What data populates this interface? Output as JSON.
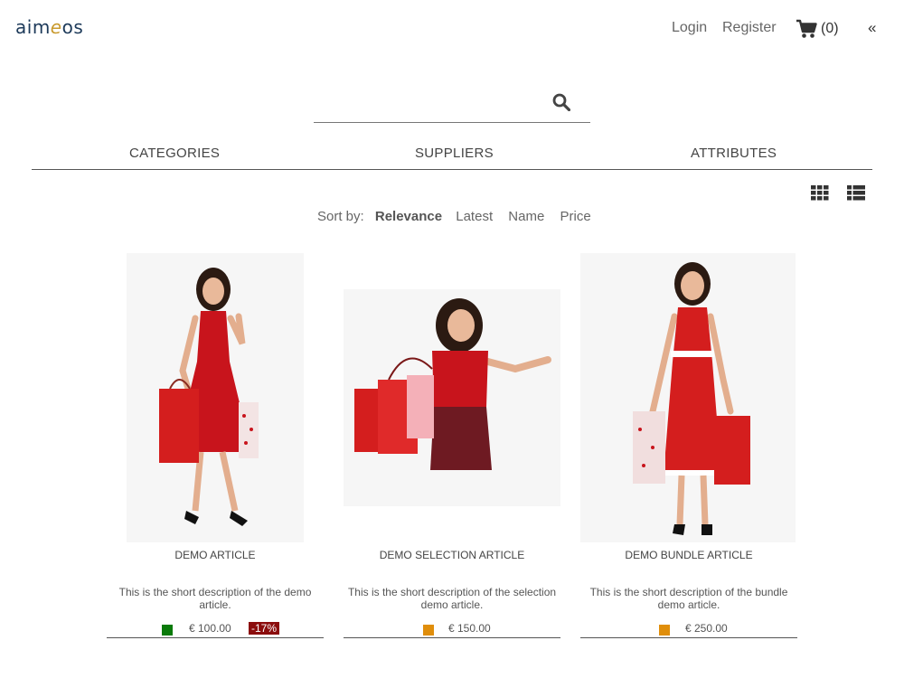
{
  "header": {
    "logo_prefix": "aim",
    "logo_e": "e",
    "logo_suffix": "os",
    "login": "Login",
    "register": "Register",
    "cart_count": "(0)",
    "collapse": "«"
  },
  "search": {
    "value": "",
    "placeholder": ""
  },
  "filters": {
    "categories": "CATEGORIES",
    "suppliers": "SUPPLIERS",
    "attributes": "ATTRIBUTES"
  },
  "sort": {
    "label": "Sort by:",
    "options": [
      "Relevance",
      "Latest",
      "Name",
      "Price"
    ],
    "active": "Relevance"
  },
  "products": [
    {
      "name": "DEMO ARTICLE",
      "description": "This is the short description of the demo article.",
      "price": "€ 100.00",
      "rebate": "-17%",
      "stock_color": "#0a7a0a"
    },
    {
      "name": "DEMO SELECTION ARTICLE",
      "description": "This is the short description of the selection demo article.",
      "price": "€ 150.00",
      "rebate": "",
      "stock_color": "#e08e0b"
    },
    {
      "name": "DEMO BUNDLE ARTICLE",
      "description": "This is the short description of the bundle demo article.",
      "price": "€ 250.00",
      "rebate": "",
      "stock_color": "#e08e0b"
    }
  ],
  "icons": {
    "cart": "shopping-cart-icon",
    "search": "search-icon",
    "grid_view": "grid-view-icon",
    "list_view": "list-view-icon"
  },
  "colors": {
    "rebate_bg": "#8b0d0d",
    "brand_blue": "#1d3a5a",
    "brand_gold": "#c99a2e"
  }
}
